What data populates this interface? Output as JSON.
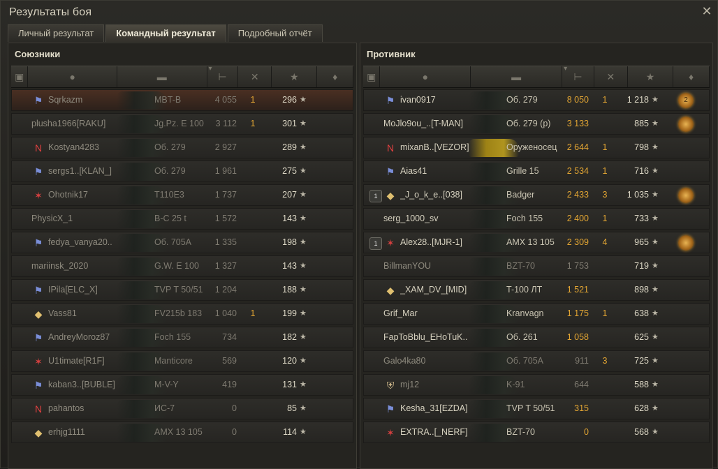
{
  "window": {
    "title": "Результаты боя",
    "close_icon": "close-icon"
  },
  "tabs": [
    {
      "label": "Личный результат",
      "active": false
    },
    {
      "label": "Командный результат",
      "active": true
    },
    {
      "label": "Подробный отчёт",
      "active": false
    }
  ],
  "columns": [
    "platoon-icon",
    "player-icon",
    "tank-icon",
    "damage-icon",
    "kills-icon",
    "xp-star-icon",
    "medal-icon"
  ],
  "sort_indicator": "chevron-down-icon",
  "allies": {
    "title": "Союзники",
    "rows": [
      {
        "name": "Sqrkazm",
        "tank": "MBT-B",
        "damage": "4 055",
        "kills": "1",
        "xp": "296",
        "dead": true,
        "self": true,
        "icon": "clan-emblem-icon"
      },
      {
        "name": "plusha1966[RAKU]",
        "tank": "Jg.Pz. E 100",
        "damage": "3 112",
        "kills": "1",
        "xp": "301",
        "dead": true,
        "self": false,
        "icon": ""
      },
      {
        "name": "Kostyan4283",
        "tank": "Об. 279",
        "damage": "2 927",
        "kills": "",
        "xp": "289",
        "dead": true,
        "self": false,
        "icon": "nerf-emblem-icon"
      },
      {
        "name": "sergs1..[KLAN_]",
        "tank": "Об. 279",
        "damage": "1 961",
        "kills": "",
        "xp": "275",
        "dead": true,
        "self": false,
        "icon": "clan-emblem-icon"
      },
      {
        "name": "Ohotnik17",
        "tank": "T110E3",
        "damage": "1 737",
        "kills": "",
        "xp": "207",
        "dead": true,
        "self": false,
        "icon": "star-emblem-icon"
      },
      {
        "name": "PhysicX_1",
        "tank": "В-С 25 t",
        "damage": "1 572",
        "kills": "",
        "xp": "143",
        "dead": true,
        "self": false,
        "icon": ""
      },
      {
        "name": "fedya_vanya20..",
        "tank": "Об. 705А",
        "damage": "1 335",
        "kills": "",
        "xp": "198",
        "dead": true,
        "self": false,
        "icon": "clan-emblem-icon"
      },
      {
        "name": "mariinsk_2020",
        "tank": "G.W. E 100",
        "damage": "1 327",
        "kills": "",
        "xp": "143",
        "dead": true,
        "self": false,
        "icon": ""
      },
      {
        "name": "IPila[ELC_X]",
        "tank": "TVP T 50/51",
        "damage": "1 204",
        "kills": "",
        "xp": "188",
        "dead": true,
        "self": false,
        "icon": "clan-emblem-icon"
      },
      {
        "name": "Vass81",
        "tank": "FV215b 183",
        "damage": "1 040",
        "kills": "1",
        "xp": "199",
        "dead": true,
        "self": false,
        "icon": "diamond-emblem-icon"
      },
      {
        "name": "AndreyMoroz87",
        "tank": "Foch 155",
        "damage": "734",
        "kills": "",
        "xp": "182",
        "dead": true,
        "self": false,
        "icon": "clan-emblem-icon"
      },
      {
        "name": "U1timate[R1F]",
        "tank": "Manticore",
        "damage": "569",
        "kills": "",
        "xp": "120",
        "dead": true,
        "self": false,
        "icon": "star-emblem-icon"
      },
      {
        "name": "kaban3..[BUBLE]",
        "tank": "M-V-Y",
        "damage": "419",
        "kills": "",
        "xp": "131",
        "dead": true,
        "self": false,
        "icon": "clan-emblem-icon"
      },
      {
        "name": "pahantos",
        "tank": "ИС-7",
        "damage": "0",
        "kills": "",
        "xp": "85",
        "dead": true,
        "self": false,
        "icon": "nerf-emblem-icon"
      },
      {
        "name": "erhjg1111",
        "tank": "AMX 13 105",
        "damage": "0",
        "kills": "",
        "xp": "114",
        "dead": true,
        "self": false,
        "icon": "diamond-emblem-icon"
      }
    ]
  },
  "enemies": {
    "title": "Противник",
    "rows": [
      {
        "name": "ivan0917",
        "tank": "Об. 279",
        "damage": "8 050",
        "kills": "1",
        "xp": "1 218",
        "dead": false,
        "platoon": "",
        "icon": "clan-emblem-icon",
        "medal": "2",
        "gold": false
      },
      {
        "name": "MoJlo9ou_..[T-MAN]",
        "tank": "Об. 279 (р)",
        "damage": "3 133",
        "kills": "",
        "xp": "885",
        "dead": false,
        "platoon": "",
        "icon": "",
        "medal": " ",
        "gold": false
      },
      {
        "name": "mixanB..[VEZOR]",
        "tank": "Оруженосец",
        "damage": "2 644",
        "kills": "1",
        "xp": "798",
        "dead": false,
        "platoon": "",
        "icon": "nerf-emblem-icon",
        "medal": "",
        "gold": true
      },
      {
        "name": "Aias41",
        "tank": "Grille 15",
        "damage": "2 534",
        "kills": "1",
        "xp": "716",
        "dead": false,
        "platoon": "",
        "icon": "clan-emblem-icon",
        "medal": "",
        "gold": false
      },
      {
        "name": "_J_o_k_e..[038]",
        "tank": "Badger",
        "damage": "2 433",
        "kills": "3",
        "xp": "1 035",
        "dead": false,
        "platoon": "1",
        "icon": "diamond-emblem-icon",
        "medal": " ",
        "gold": false
      },
      {
        "name": "serg_1000_sv",
        "tank": "Foch 155",
        "damage": "2 400",
        "kills": "1",
        "xp": "733",
        "dead": false,
        "platoon": "",
        "icon": "",
        "medal": "",
        "gold": false
      },
      {
        "name": "Alex28..[MJR-1]",
        "tank": "AMX 13 105",
        "damage": "2 309",
        "kills": "4",
        "xp": "965",
        "dead": false,
        "platoon": "1",
        "icon": "star-emblem-icon",
        "medal": " ",
        "gold": false
      },
      {
        "name": "BillmanYOU",
        "tank": "BZT-70",
        "damage": "1 753",
        "kills": "",
        "xp": "719",
        "dead": true,
        "platoon": "",
        "icon": "",
        "medal": "",
        "gold": false
      },
      {
        "name": "_XAM_DV_[MID]",
        "tank": "T-100 ЛТ",
        "damage": "1 521",
        "kills": "",
        "xp": "898",
        "dead": false,
        "platoon": "",
        "icon": "diamond-emblem-icon",
        "medal": "",
        "gold": false
      },
      {
        "name": "Grif_Mar",
        "tank": "Kranvagn",
        "damage": "1 175",
        "kills": "1",
        "xp": "638",
        "dead": false,
        "platoon": "",
        "icon": "",
        "medal": "",
        "gold": false
      },
      {
        "name": "FapToBblu_EHoTuK..",
        "tank": "Об. 261",
        "damage": "1 058",
        "kills": "",
        "xp": "625",
        "dead": false,
        "platoon": "",
        "icon": "",
        "medal": "",
        "gold": false
      },
      {
        "name": "Galo4ka80",
        "tank": "Об. 705А",
        "damage": "911",
        "kills": "3",
        "xp": "725",
        "dead": true,
        "platoon": "",
        "icon": "",
        "medal": "",
        "gold": false
      },
      {
        "name": "mj12",
        "tank": "K-91",
        "damage": "644",
        "kills": "",
        "xp": "588",
        "dead": true,
        "platoon": "",
        "icon": "shield-emblem-icon",
        "medal": "",
        "gold": false
      },
      {
        "name": "Kesha_31[EZDA]",
        "tank": "TVP T 50/51",
        "damage": "315",
        "kills": "",
        "xp": "628",
        "dead": false,
        "platoon": "",
        "icon": "clan-emblem-icon",
        "medal": "",
        "gold": false
      },
      {
        "name": "EXTRA..[_NERF]",
        "tank": "BZT-70",
        "damage": "0",
        "kills": "",
        "xp": "568",
        "dead": false,
        "platoon": "",
        "icon": "star-emblem-icon",
        "medal": "",
        "gold": false
      }
    ]
  },
  "star_glyph": "★",
  "colors": {
    "damage": "#e2a533",
    "self_row": "#4a2f22",
    "medal": "#e8b352"
  }
}
